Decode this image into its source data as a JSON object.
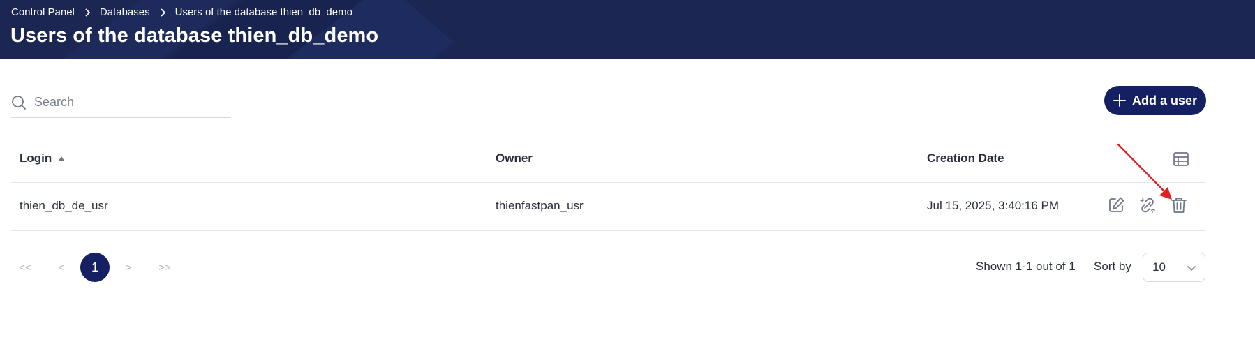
{
  "header": {
    "breadcrumb": [
      "Control Panel",
      "Databases",
      "Users of the database thien_db_demo"
    ],
    "title": "Users of the database thien_db_demo"
  },
  "search": {
    "placeholder": "Search",
    "value": ""
  },
  "add_button": {
    "label": "Add a user"
  },
  "table": {
    "columns": [
      "Login",
      "Owner",
      "Creation Date"
    ],
    "sort": {
      "column": "Login",
      "direction": "ascending"
    },
    "rows": [
      {
        "login": "thien_db_de_usr",
        "owner": "thienfastpan_usr",
        "created": "Jul 15, 2025, 3:40:16 PM"
      }
    ]
  },
  "pagination": {
    "first": "<<",
    "prev": "<",
    "current_page": "1",
    "next": ">",
    "last": ">>",
    "shown": "Shown 1-1 out of 1",
    "sort_by_label": "Sort by",
    "sort_by_value": "10"
  },
  "colors": {
    "header_bg": "#1b2653",
    "accent": "#142062",
    "annotation_arrow": "#e32020"
  }
}
